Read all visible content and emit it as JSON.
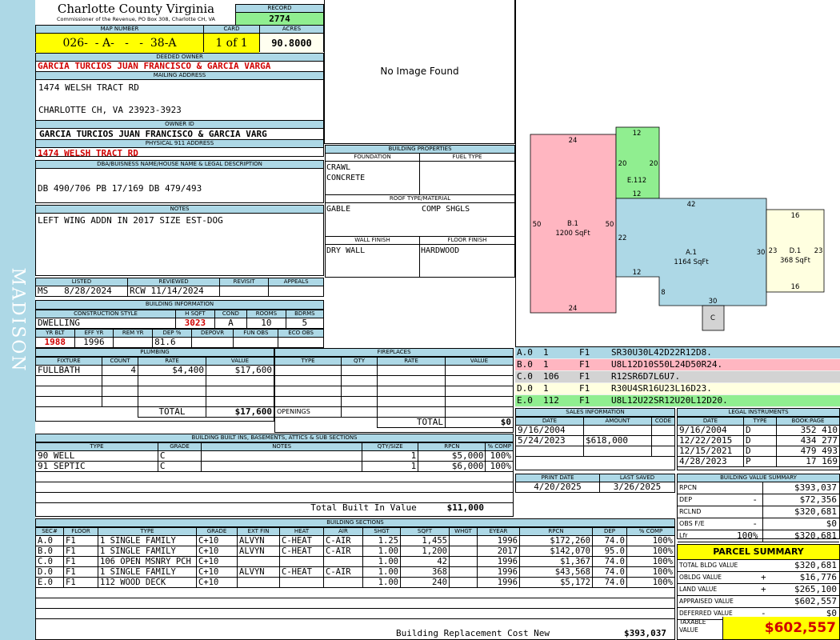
{
  "sidebar": {
    "district": "MADISON"
  },
  "header": {
    "county": "Charlotte County Virginia",
    "office": "Commissioner of the Revenue, PO Box 308, Charlotte CH, VA",
    "record_label": "RECORD",
    "record": "2774",
    "map_label": "MAP NUMBER",
    "map": "026-  - A-   -   -  38-A",
    "card_label": "CARD",
    "card": "1 of 1",
    "acres_label": "ACRES",
    "acres": "90.8000"
  },
  "owner": {
    "deeded_label": "DEEDED OWNER",
    "deeded": "GARCIA TURCIOS JUAN FRANCISCO & GARCIA VARGA",
    "mailing_label": "MAILING ADDRESS",
    "mail1": "1474 WELSH TRACT RD",
    "mail2": "CHARLOTTE CH, VA 23923-3923",
    "ownerid_label": "OWNER ID",
    "ownerid": "GARCIA TURCIOS JUAN FRANCISCO & GARCIA VARG",
    "phys_label": "PHYSICAL 911 ADDRESS",
    "phys": "1474 WELSH TRACT RD"
  },
  "legal": {
    "label": "DBA/BUISNESS NAME/HOUSE NAME & LEGAL DESCRIPTION",
    "text": "DB 490/706 PB 17/169 DB 479/493"
  },
  "notes": {
    "label": "NOTES",
    "text": "LEFT WING ADDN IN 2017 SIZE EST-DOG"
  },
  "review": {
    "listed_label": "LISTED",
    "reviewed_label": "REVIEWED",
    "revisit_label": "REVISIT",
    "appeals_label": "APPEALS",
    "listed_by": "MS",
    "listed_date": "8/28/2024",
    "reviewed": "RCW 11/14/2024"
  },
  "building_info": {
    "label": "BUILDING INFORMATION",
    "cs_label": "CONSTRUCTION STYLE",
    "hsqft_label": "H SQFT",
    "cond_label": "COND",
    "rooms_label": "ROOMS",
    "bdrms_label": "BDRMS",
    "style": "DWELLING",
    "hsqft": "3023",
    "cond": "A",
    "rooms": "10",
    "bdrms": "5",
    "yrblt_label": "YR BLT",
    "effyr_label": "EFF YR",
    "remyr_label": "REM YR",
    "dep_label": "DEP %",
    "depovr_label": "DEPOVR",
    "funobs_label": "FUN OBS",
    "ecoobs_label": "ECO OBS",
    "yrblt": "1988",
    "effyr": "1996",
    "dep": "81.6"
  },
  "photo": {
    "text": "No Image Found"
  },
  "bldg_props": {
    "label": "BUILDING PROPERTIES",
    "foundation_label": "FOUNDATION",
    "fuel_label": "FUEL TYPE",
    "foundation1": "CRAWL",
    "foundation2": "CONCRETE",
    "roof_label": "ROOF TYPE/MATERIAL",
    "roof_type": "GABLE",
    "roof_mat": "COMP SHGLS",
    "wall_label": "WALL FINISH",
    "floor_label": "FLOOR FINISH",
    "wall": "DRY WALL",
    "floor": "HARDWOOD"
  },
  "sketch": {
    "areas": [
      {
        "id": "B.1",
        "sqft": "1200 SqFt",
        "color": "#ffb6c1"
      },
      {
        "id": "E.112",
        "color": "#90ee90"
      },
      {
        "id": "A.1",
        "sqft": "1164 SqFt",
        "color": "#add8e6"
      },
      {
        "id": "D.1",
        "sqft": "368 SqFt",
        "color": "#ffffe0"
      },
      {
        "id": "C",
        "color": "#d3d3d3"
      }
    ],
    "dims": {
      "b_top": "24",
      "b_left": "50",
      "b_right": "50",
      "b_bottom": "24",
      "e_top": "12",
      "e_left": "20",
      "e_right": "20",
      "e_bottom": "12",
      "a_top": "42",
      "a_left": "22",
      "a_right": "30",
      "a_inner": "12",
      "a_notch": "8",
      "a_bottom": "30",
      "d_top": "16",
      "d_left": "23",
      "d_right": "23",
      "d_bottom": "16"
    }
  },
  "codes": [
    {
      "sec": "A.0",
      "n": "1",
      "fl": "F1",
      "code": "SR30U30L42D22R12D8.",
      "color": "#add8e6"
    },
    {
      "sec": "B.0",
      "n": "1",
      "fl": "F1",
      "code": "U8L12D10S50L24D50R24.",
      "color": "#ffb6c1"
    },
    {
      "sec": "C.0",
      "n": "106",
      "fl": "F1",
      "code": "R12SR6D7L6U7.",
      "color": "#d3d3d3"
    },
    {
      "sec": "D.0",
      "n": "1",
      "fl": "F1",
      "code": "R30U4SR16U23L16D23.",
      "color": "#ffffe0"
    },
    {
      "sec": "E.0",
      "n": "112",
      "fl": "F1",
      "code": "U8L12U22SR12U20L12D20.",
      "color": "#90ee90"
    }
  ],
  "plumbing": {
    "label": "PLUMBING",
    "headers": [
      "FIXTURE",
      "COUNT",
      "RATE",
      "VALUE"
    ],
    "rows": [
      [
        "FULLBATH",
        "4",
        "$4,400",
        "$17,600"
      ]
    ],
    "total_label": "TOTAL",
    "total": "$17,600"
  },
  "fireplaces": {
    "label": "FIREPLACES",
    "headers": [
      "TYPE",
      "QTY",
      "RATE",
      "VALUE"
    ],
    "openings_label": "OPENINGS",
    "total_label": "TOTAL",
    "total": "$0"
  },
  "sales": {
    "label": "SALES INFORMATION",
    "headers": [
      "DATE",
      "AMOUNT",
      "CODE"
    ],
    "rows": [
      [
        "9/16/2004",
        "",
        ""
      ],
      [
        "5/24/2023",
        "$618,000",
        ""
      ]
    ]
  },
  "legal_inst": {
    "label": "LEGAL INSTRUMENTS",
    "headers": [
      "DATE",
      "TYPE",
      "BOOK:PAGE"
    ],
    "rows": [
      [
        "9/16/2004",
        "D",
        "352 410"
      ],
      [
        "12/22/2015",
        "D",
        "434 277"
      ],
      [
        "12/15/2021",
        "D",
        "479 493"
      ],
      [
        "4/28/2023",
        "P",
        "17 169"
      ]
    ]
  },
  "print": {
    "print_label": "PRINT DATE",
    "saved_label": "LAST SAVED",
    "print": "4/20/2025",
    "saved": "3/26/2025"
  },
  "builtins": {
    "label": "BUILDING BUILT INS, BASEMENTS, ATTICS & SUB SECTIONS",
    "headers": [
      "TYPE",
      "GRADE",
      "NOTES",
      "QTY/SIZE",
      "RPCN",
      "% COMP"
    ],
    "rows": [
      [
        "90 WELL",
        "C",
        "",
        "1",
        "$5,000",
        "100%"
      ],
      [
        "91 SEPTIC",
        "C",
        "",
        "1",
        "$6,000",
        "100%"
      ]
    ],
    "total_label": "Total Built In Value",
    "total": "$11,000"
  },
  "value_summary": {
    "label": "BUILDING VALUE SUMMARY",
    "rows": [
      {
        "label": "RPCN",
        "sign": "",
        "value": "$393,037"
      },
      {
        "label": "DEP",
        "sign": "-",
        "value": "$72,356"
      },
      {
        "label": "RCLND",
        "sign": "",
        "value": "$320,681"
      },
      {
        "label": "OBS F/E",
        "sign": "-",
        "value": "$0"
      },
      {
        "label": "Lfr",
        "sign": "100%",
        "value": "$320,681"
      }
    ]
  },
  "sections": {
    "label": "BUILDING SECTIONS",
    "headers": [
      "SEC#",
      "FLOOR",
      "TYPE",
      "GRADE",
      "EXT FIN",
      "HEAT",
      "AIR",
      "SHGT",
      "SQFT",
      "WHGT",
      "EYEAR",
      "RPCN",
      "DEP",
      "% COMP"
    ],
    "rows": [
      [
        "A.0",
        "F1",
        "1 SINGLE FAMILY",
        "C+10",
        "ALVYN",
        "C-HEAT",
        "C-AIR",
        "1.25",
        "1,455",
        "",
        "1996",
        "$172,260",
        "74.0",
        "100%"
      ],
      [
        "B.0",
        "F1",
        "1 SINGLE FAMILY",
        "C+10",
        "ALVYN",
        "C-HEAT",
        "C-AIR",
        "1.00",
        "1,200",
        "",
        "2017",
        "$142,070",
        "95.0",
        "100%"
      ],
      [
        "C.0",
        "F1",
        "106 OPEN MSNRY PCH",
        "C+10",
        "",
        "",
        "",
        "1.00",
        "42",
        "",
        "1996",
        "$1,367",
        "74.0",
        "100%"
      ],
      [
        "D.0",
        "F1",
        "1 SINGLE FAMILY",
        "C+10",
        "ALVYN",
        "C-HEAT",
        "C-AIR",
        "1.00",
        "368",
        "",
        "1996",
        "$43,568",
        "74.0",
        "100%"
      ],
      [
        "E.0",
        "F1",
        "112 WOOD DECK",
        "C+10",
        "",
        "",
        "",
        "1.00",
        "240",
        "",
        "1996",
        "$5,172",
        "74.0",
        "100%"
      ]
    ],
    "total_label": "Building Replacement Cost New",
    "total": "$393,037"
  },
  "parcel": {
    "label": "PARCEL SUMMARY",
    "rows": [
      {
        "label": "TOTAL BLDG VALUE",
        "sign": "",
        "value": "$320,681"
      },
      {
        "label": "OBLDG VALUE",
        "sign": "+",
        "value": "$16,776"
      },
      {
        "label": "LAND VALUE",
        "sign": "+",
        "value": "$265,100"
      },
      {
        "label": "APPRAISED VALUE",
        "sign": "",
        "value": "$602,557"
      },
      {
        "label": "DEFERRED VALUE",
        "sign": "-",
        "value": "$0"
      }
    ],
    "taxable_label": "TAXABLE VALUE",
    "taxable": "$602,557"
  }
}
